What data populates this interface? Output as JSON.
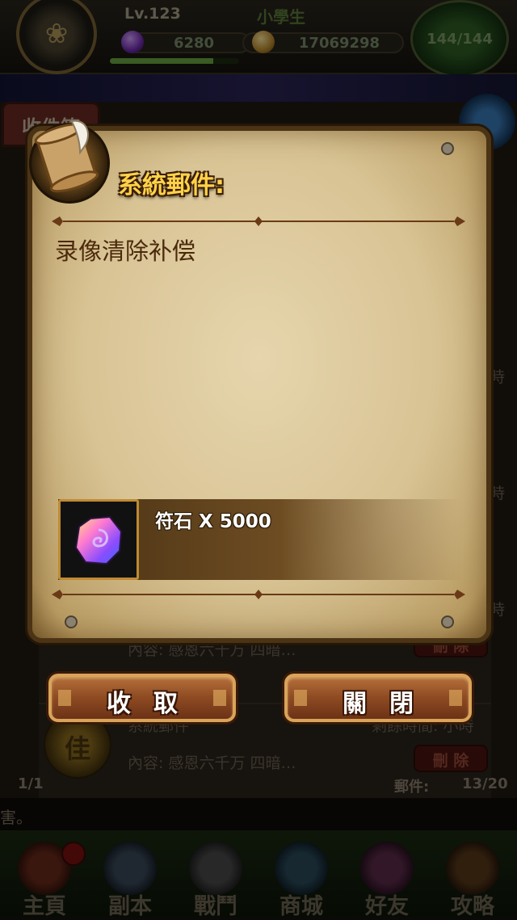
{
  "hud": {
    "level": "Lv.123",
    "player_name": "小學生",
    "gems": "6280",
    "gold": "17069298",
    "energy": "144/144",
    "xp_fraction": 0.8
  },
  "background_list": {
    "inbox_tab": "收件箱",
    "rows": [
      {
        "content": "內容: 感恩六千万 四暗…",
        "delete_label": "刪 除"
      },
      {
        "title": "系統郵件",
        "time": "剩餘時間: 小時",
        "content": "內容: 感恩六千万 四暗…",
        "delete_label": "刪 除"
      }
    ],
    "time_fragment": "時",
    "page_indicator": "1/1",
    "mail_label": "郵件:",
    "mail_count": "13/20",
    "ticker": "害。"
  },
  "bottom_nav": {
    "items": [
      {
        "label": "主頁",
        "icon": "home-icon",
        "color": "#6a2a1a"
      },
      {
        "label": "副本",
        "icon": "dungeon-icon",
        "color": "#3a4a5a"
      },
      {
        "label": "戰鬥",
        "icon": "battle-icon",
        "color": "#4a4a4a"
      },
      {
        "label": "商城",
        "icon": "shop-icon",
        "color": "#2a4a5a"
      },
      {
        "label": "好友",
        "icon": "friends-icon",
        "color": "#5a2a4a"
      },
      {
        "label": "攻略",
        "icon": "guide-icon",
        "color": "#5a3a1a"
      }
    ]
  },
  "modal": {
    "title": "系統郵件:",
    "subject": "录像清除补偿",
    "reward": {
      "text": "符石 X 5000",
      "icon": "rune-stone-icon"
    },
    "buttons": {
      "collect": "收取",
      "close": "關閉"
    }
  },
  "colors": {
    "title_gold": "#ffd24a",
    "parchment": "#d8c394",
    "button_brown": "#8d4a22",
    "button_border": "#d9a45a"
  }
}
